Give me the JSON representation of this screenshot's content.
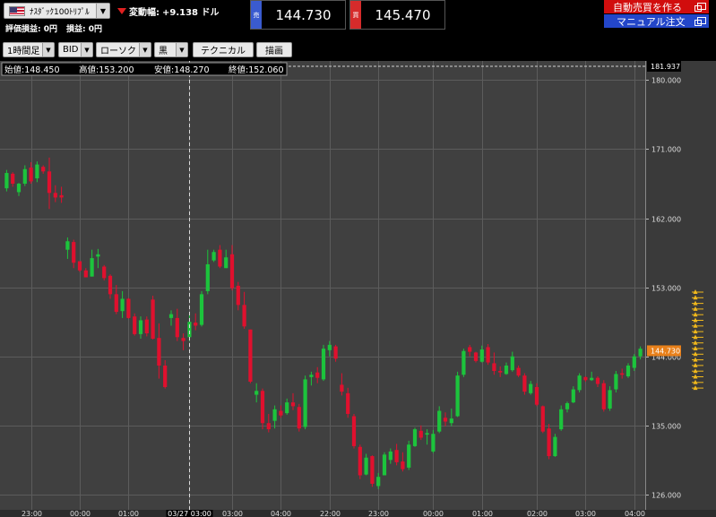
{
  "header": {
    "symbol": "ﾅｽﾀﾞｯｸ100ﾄﾘﾌﾟﾙ",
    "change_label": "変動幅:",
    "change_value": "+9.138 ドル",
    "pl_eval_label": "評価損益:",
    "pl_eval_value": "0円",
    "pl_label": "損益:",
    "pl_value": "0円"
  },
  "prices": {
    "sell_tag": "売",
    "sell_value": "144.730",
    "buy_tag": "買",
    "buy_value": "145.470"
  },
  "buttons": {
    "auto_trade": "自動売買を作る",
    "manual_order": "マニュアル注文"
  },
  "toolbar": {
    "timeframe": "1時間足",
    "price_type": "BID",
    "chart_style": "ローソク",
    "color_scheme": "黒",
    "technical": "テクニカル",
    "drawing": "描画"
  },
  "ohlc": {
    "open_label": "始値:",
    "open": "148.450",
    "high_label": "高値:",
    "high": "153.200",
    "low_label": "安値:",
    "low": "148.270",
    "close_label": "終値:",
    "close": "152.060"
  },
  "colors": {
    "up": "#1cc43c",
    "down": "#e0102e",
    "background": "#404040",
    "grid": "#5c5c5c",
    "price_tag": "#e8801a"
  },
  "chart_data": {
    "type": "candlestick",
    "y_ticks": [
      "180.000",
      "171.000",
      "162.000",
      "153.000",
      "144.000",
      "135.000",
      "126.000"
    ],
    "y_tick_values": [
      180,
      171,
      162,
      153,
      144,
      135,
      126
    ],
    "ylim": [
      124,
      182.5
    ],
    "top_value_label": "181.937",
    "current_price": 144.73,
    "current_price_label": "144.730",
    "crosshair_x_label": "03/27 03:00",
    "crosshair_index": 30,
    "x_tick_labels": [
      "23:00",
      "00:00",
      "01:00",
      "02:00",
      "03:00",
      "04:00",
      "22:00",
      "23:00",
      "00:00",
      "01:00",
      "02:00",
      "03:00",
      "04:00"
    ],
    "x_tick_indices": [
      4,
      12,
      20,
      30,
      37,
      45,
      53,
      61,
      70,
      78,
      87,
      95,
      103
    ],
    "candles": [
      [
        165.9,
        168.3,
        165.5,
        167.9
      ],
      [
        167.8,
        168.0,
        166.1,
        166.5
      ],
      [
        165.4,
        166.6,
        164.9,
        166.5
      ],
      [
        166.5,
        168.9,
        166.2,
        168.4
      ],
      [
        168.6,
        169.3,
        166.5,
        166.8
      ],
      [
        167.2,
        169.4,
        166.7,
        169.0
      ],
      [
        168.7,
        168.9,
        167.8,
        168.1
      ],
      [
        168.1,
        169.9,
        163.2,
        165.3
      ],
      [
        165.3,
        166.3,
        164.1,
        164.7
      ],
      [
        165.0,
        166.1,
        164.0,
        164.7
      ],
      [
        157.9,
        159.5,
        156.7,
        159.0
      ],
      [
        158.9,
        159.2,
        155.5,
        156.2
      ],
      [
        156.4,
        156.4,
        155.0,
        155.2
      ],
      [
        155.2,
        155.5,
        154.3,
        154.3
      ],
      [
        154.4,
        157.9,
        154.4,
        156.8
      ],
      [
        157.0,
        158.0,
        155.5,
        157.3
      ],
      [
        155.7,
        155.9,
        153.9,
        154.2
      ],
      [
        154.5,
        154.7,
        151.5,
        152.1
      ],
      [
        152.1,
        153.3,
        149.5,
        149.8
      ],
      [
        149.9,
        152.5,
        149.0,
        151.5
      ],
      [
        151.5,
        151.6,
        148.9,
        149.0
      ],
      [
        149.2,
        149.6,
        146.7,
        146.9
      ],
      [
        146.9,
        149.2,
        146.3,
        148.7
      ],
      [
        148.8,
        149.2,
        146.6,
        147.0
      ],
      [
        151.4,
        151.9,
        146.2,
        146.3
      ],
      [
        146.4,
        148.3,
        141.1,
        142.8
      ],
      [
        142.8,
        143.5,
        139.8,
        140.0
      ],
      [
        149.0,
        150.0,
        148.0,
        149.5
      ],
      [
        149.0,
        150.2,
        146.0,
        146.5
      ],
      [
        146.4,
        147.0,
        144.8,
        146.0
      ],
      [
        146.5,
        149.5,
        146.0,
        148.5
      ],
      [
        148.4,
        149.6,
        147.4,
        148.0
      ],
      [
        148.1,
        152.5,
        147.9,
        152.1
      ],
      [
        152.5,
        157.9,
        152.1,
        156.0
      ],
      [
        156.5,
        157.9,
        156.3,
        157.6
      ],
      [
        157.9,
        158.5,
        155.5,
        155.7
      ],
      [
        155.5,
        157.9,
        155.5,
        156.9
      ],
      [
        157.3,
        158.5,
        152.6,
        152.9
      ],
      [
        153.2,
        153.7,
        150.0,
        150.7
      ],
      [
        150.7,
        152.4,
        147.6,
        147.9
      ],
      [
        147.5,
        147.5,
        140.5,
        140.7
      ],
      [
        139.0,
        140.5,
        138.0,
        139.5
      ],
      [
        139.5,
        139.8,
        134.5,
        135.3
      ],
      [
        135.3,
        136.5,
        134.1,
        134.5
      ],
      [
        135.6,
        137.6,
        134.6,
        137.1
      ],
      [
        136.9,
        137.6,
        136.0,
        136.3
      ],
      [
        136.6,
        138.5,
        136.4,
        138.0
      ],
      [
        138.0,
        139.2,
        137.0,
        137.5
      ],
      [
        137.4,
        137.8,
        134.2,
        134.6
      ],
      [
        134.8,
        141.5,
        134.5,
        141.0
      ],
      [
        141.3,
        142.0,
        140.2,
        141.6
      ],
      [
        141.9,
        142.6,
        140.5,
        141.2
      ],
      [
        141.0,
        145.5,
        140.8,
        145.0
      ],
      [
        144.8,
        146.0,
        144.0,
        145.5
      ],
      [
        145.3,
        145.5,
        143.3,
        143.7
      ],
      [
        140.3,
        141.8,
        138.9,
        139.4
      ],
      [
        139.2,
        139.9,
        136.0,
        136.5
      ],
      [
        136.2,
        136.5,
        132.0,
        132.3
      ],
      [
        132.2,
        132.5,
        128.0,
        128.5
      ],
      [
        128.6,
        131.3,
        128.5,
        130.8
      ],
      [
        131.0,
        131.1,
        127.0,
        127.4
      ],
      [
        127.1,
        128.8,
        126.7,
        128.3
      ],
      [
        128.5,
        131.5,
        128.5,
        131.2
      ],
      [
        130.5,
        132.0,
        130.0,
        131.6
      ],
      [
        131.8,
        132.6,
        129.8,
        130.2
      ],
      [
        130.3,
        131.5,
        129.0,
        129.3
      ],
      [
        129.5,
        133.0,
        129.2,
        132.5
      ],
      [
        132.3,
        134.7,
        132.2,
        134.5
      ],
      [
        134.3,
        135.0,
        133.1,
        133.4
      ],
      [
        133.8,
        134.5,
        132.5,
        134.0
      ],
      [
        131.6,
        134.4,
        131.4,
        133.9
      ],
      [
        134.2,
        137.5,
        134.0,
        136.9
      ],
      [
        136.0,
        136.7,
        134.9,
        135.5
      ],
      [
        135.3,
        137.2,
        134.9,
        135.9
      ],
      [
        136.2,
        142.0,
        136.1,
        141.5
      ],
      [
        141.6,
        145.0,
        141.3,
        144.7
      ],
      [
        145.2,
        145.5,
        144.0,
        144.6
      ],
      [
        144.5,
        144.6,
        143.2,
        143.4
      ],
      [
        143.3,
        145.4,
        143.2,
        144.9
      ],
      [
        145.2,
        145.6,
        142.9,
        143.2
      ],
      [
        143.1,
        144.5,
        141.6,
        142.1
      ],
      [
        142.1,
        142.7,
        141.3,
        141.9
      ],
      [
        141.7,
        143.2,
        141.6,
        142.8
      ],
      [
        142.2,
        144.6,
        142.0,
        144.0
      ],
      [
        142.5,
        142.8,
        141.3,
        141.5
      ],
      [
        141.5,
        141.8,
        139.0,
        139.4
      ],
      [
        139.2,
        140.8,
        139.0,
        140.4
      ],
      [
        140.0,
        140.5,
        137.5,
        137.7
      ],
      [
        137.5,
        137.6,
        134.0,
        134.2
      ],
      [
        134.6,
        135.2,
        130.6,
        131.0
      ],
      [
        131.0,
        133.9,
        130.9,
        133.5
      ],
      [
        134.5,
        137.6,
        134.3,
        137.1
      ],
      [
        137.1,
        138.1,
        136.7,
        137.9
      ],
      [
        138.0,
        140.1,
        137.9,
        139.7
      ],
      [
        139.6,
        141.8,
        139.3,
        141.5
      ],
      [
        141.3,
        141.4,
        140.7,
        140.9
      ],
      [
        140.9,
        142.0,
        140.8,
        141.2
      ],
      [
        141.2,
        141.4,
        140.0,
        140.4
      ],
      [
        140.5,
        140.9,
        136.8,
        137.1
      ],
      [
        137.2,
        140.1,
        136.9,
        139.6
      ],
      [
        139.7,
        142.1,
        139.3,
        141.7
      ],
      [
        141.8,
        142.4,
        141.1,
        141.6
      ],
      [
        141.4,
        143.1,
        141.2,
        142.8
      ],
      [
        142.5,
        144.3,
        142.1,
        144.0
      ],
      [
        144.0,
        145.3,
        143.6,
        145.0
      ]
    ]
  }
}
